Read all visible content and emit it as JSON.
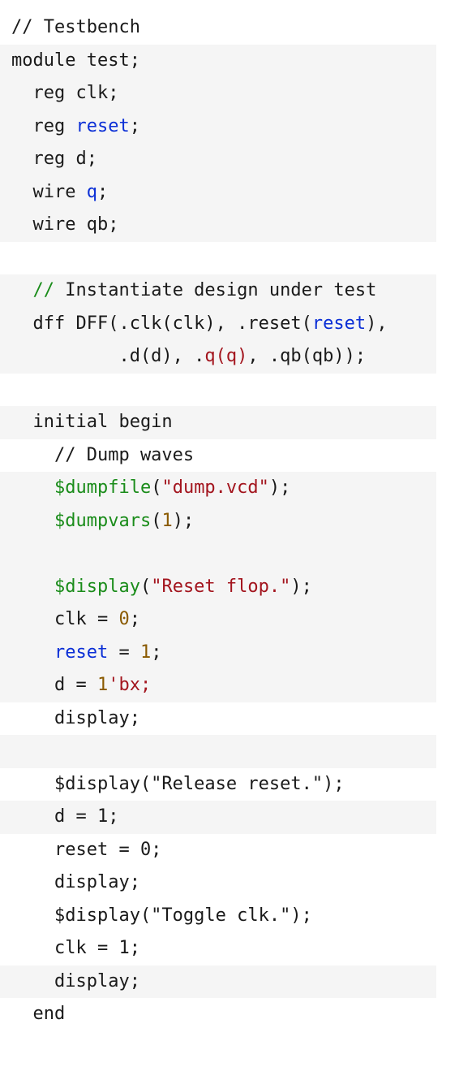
{
  "colors": {
    "plain": "#1a1a1a",
    "comment": "#1a8c1a",
    "keyword": "#1a1a1a",
    "identifier": "#0b2fd6",
    "port": "#a3151e",
    "string": "#a3151e",
    "number": "#8a5a00",
    "system_task": "#1a8c1a"
  },
  "code_lines": [
    {
      "shade": false,
      "tokens": [
        {
          "t": "// Testbench",
          "c": "plain"
        }
      ]
    },
    {
      "shade": true,
      "tokens": [
        {
          "t": "module test;",
          "c": "plain"
        }
      ]
    },
    {
      "shade": true,
      "tokens": [
        {
          "t": "  reg clk;",
          "c": "plain"
        }
      ]
    },
    {
      "shade": true,
      "tokens": [
        {
          "t": "  reg ",
          "c": "plain"
        },
        {
          "t": "reset",
          "c": "identifier"
        },
        {
          "t": ";",
          "c": "plain"
        }
      ]
    },
    {
      "shade": true,
      "tokens": [
        {
          "t": "  reg d;",
          "c": "plain"
        }
      ]
    },
    {
      "shade": true,
      "tokens": [
        {
          "t": "  wire ",
          "c": "plain"
        },
        {
          "t": "q",
          "c": "identifier"
        },
        {
          "t": ";",
          "c": "plain"
        }
      ]
    },
    {
      "shade": true,
      "tokens": [
        {
          "t": "  wire qb;",
          "c": "plain"
        }
      ]
    },
    {
      "shade": false,
      "tokens": [
        {
          "t": "",
          "c": "plain"
        }
      ]
    },
    {
      "shade": true,
      "tokens": [
        {
          "t": "  ",
          "c": "plain"
        },
        {
          "t": "//",
          "c": "comment"
        },
        {
          "t": " Instantiate design under test",
          "c": "plain"
        }
      ]
    },
    {
      "shade": true,
      "tokens": [
        {
          "t": "  dff DFF(.clk(clk), .reset(",
          "c": "plain"
        },
        {
          "t": "reset",
          "c": "identifier"
        },
        {
          "t": "),",
          "c": "plain"
        }
      ]
    },
    {
      "shade": true,
      "tokens": [
        {
          "t": "          .d(d), .",
          "c": "plain"
        },
        {
          "t": "q(q)",
          "c": "port"
        },
        {
          "t": ", .qb(qb));",
          "c": "plain"
        }
      ]
    },
    {
      "shade": false,
      "tokens": [
        {
          "t": "",
          "c": "plain"
        }
      ]
    },
    {
      "shade": true,
      "tokens": [
        {
          "t": "  initial begin",
          "c": "plain"
        }
      ]
    },
    {
      "shade": false,
      "tokens": [
        {
          "t": "    // Dump waves",
          "c": "plain"
        }
      ]
    },
    {
      "shade": true,
      "tokens": [
        {
          "t": "    ",
          "c": "plain"
        },
        {
          "t": "$dumpfile",
          "c": "system_task"
        },
        {
          "t": "(",
          "c": "plain"
        },
        {
          "t": "\"dump.vcd\"",
          "c": "string"
        },
        {
          "t": ");",
          "c": "plain"
        }
      ]
    },
    {
      "shade": true,
      "tokens": [
        {
          "t": "    ",
          "c": "plain"
        },
        {
          "t": "$dumpvars",
          "c": "system_task"
        },
        {
          "t": "(",
          "c": "plain"
        },
        {
          "t": "1",
          "c": "number"
        },
        {
          "t": ");",
          "c": "plain"
        }
      ]
    },
    {
      "shade": true,
      "tokens": [
        {
          "t": "",
          "c": "plain"
        }
      ]
    },
    {
      "shade": true,
      "tokens": [
        {
          "t": "    ",
          "c": "plain"
        },
        {
          "t": "$display",
          "c": "system_task"
        },
        {
          "t": "(",
          "c": "plain"
        },
        {
          "t": "\"Reset flop.\"",
          "c": "string"
        },
        {
          "t": ");",
          "c": "plain"
        }
      ]
    },
    {
      "shade": true,
      "tokens": [
        {
          "t": "    clk = ",
          "c": "plain"
        },
        {
          "t": "0",
          "c": "number"
        },
        {
          "t": ";",
          "c": "plain"
        }
      ]
    },
    {
      "shade": true,
      "tokens": [
        {
          "t": "    ",
          "c": "plain"
        },
        {
          "t": "reset",
          "c": "identifier"
        },
        {
          "t": " = ",
          "c": "plain"
        },
        {
          "t": "1",
          "c": "number"
        },
        {
          "t": ";",
          "c": "plain"
        }
      ]
    },
    {
      "shade": true,
      "tokens": [
        {
          "t": "    d = ",
          "c": "plain"
        },
        {
          "t": "1",
          "c": "number"
        },
        {
          "t": "'bx;",
          "c": "string"
        }
      ]
    },
    {
      "shade": false,
      "tokens": [
        {
          "t": "    display;",
          "c": "plain"
        }
      ]
    },
    {
      "shade": true,
      "tokens": [
        {
          "t": "",
          "c": "plain"
        }
      ]
    },
    {
      "shade": false,
      "tokens": [
        {
          "t": "    $display(\"Release reset.\");",
          "c": "plain"
        }
      ]
    },
    {
      "shade": true,
      "tokens": [
        {
          "t": "    d = 1;",
          "c": "plain"
        }
      ]
    },
    {
      "shade": false,
      "tokens": [
        {
          "t": "    reset = 0;",
          "c": "plain"
        }
      ]
    },
    {
      "shade": false,
      "tokens": [
        {
          "t": "    display;",
          "c": "plain"
        }
      ]
    },
    {
      "shade": false,
      "tokens": [
        {
          "t": "    $display(\"Toggle clk.\");",
          "c": "plain"
        }
      ]
    },
    {
      "shade": false,
      "tokens": [
        {
          "t": "    clk = 1;",
          "c": "plain"
        }
      ]
    },
    {
      "shade": true,
      "tokens": [
        {
          "t": "    display;",
          "c": "plain"
        }
      ]
    },
    {
      "shade": false,
      "tokens": [
        {
          "t": "  end",
          "c": "plain"
        }
      ]
    }
  ]
}
